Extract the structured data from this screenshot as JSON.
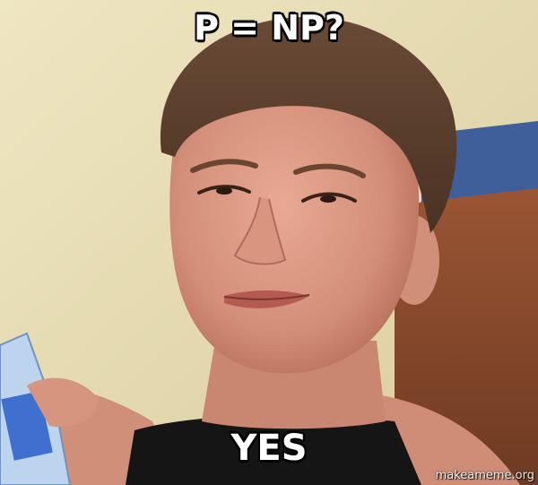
{
  "meme": {
    "top_text": "P = NP?",
    "bottom_text": "YES",
    "watermark": "makeameme.org"
  },
  "colors": {
    "wall": "#e9dfb6",
    "headboard": "#8a4a2a",
    "headboard_top": "#3f5f9a",
    "skin": "#d89a84",
    "hair": "#5a3e2e",
    "shirt": "#151515",
    "caption_fill": "#ffffff",
    "caption_outline": "#000000"
  }
}
